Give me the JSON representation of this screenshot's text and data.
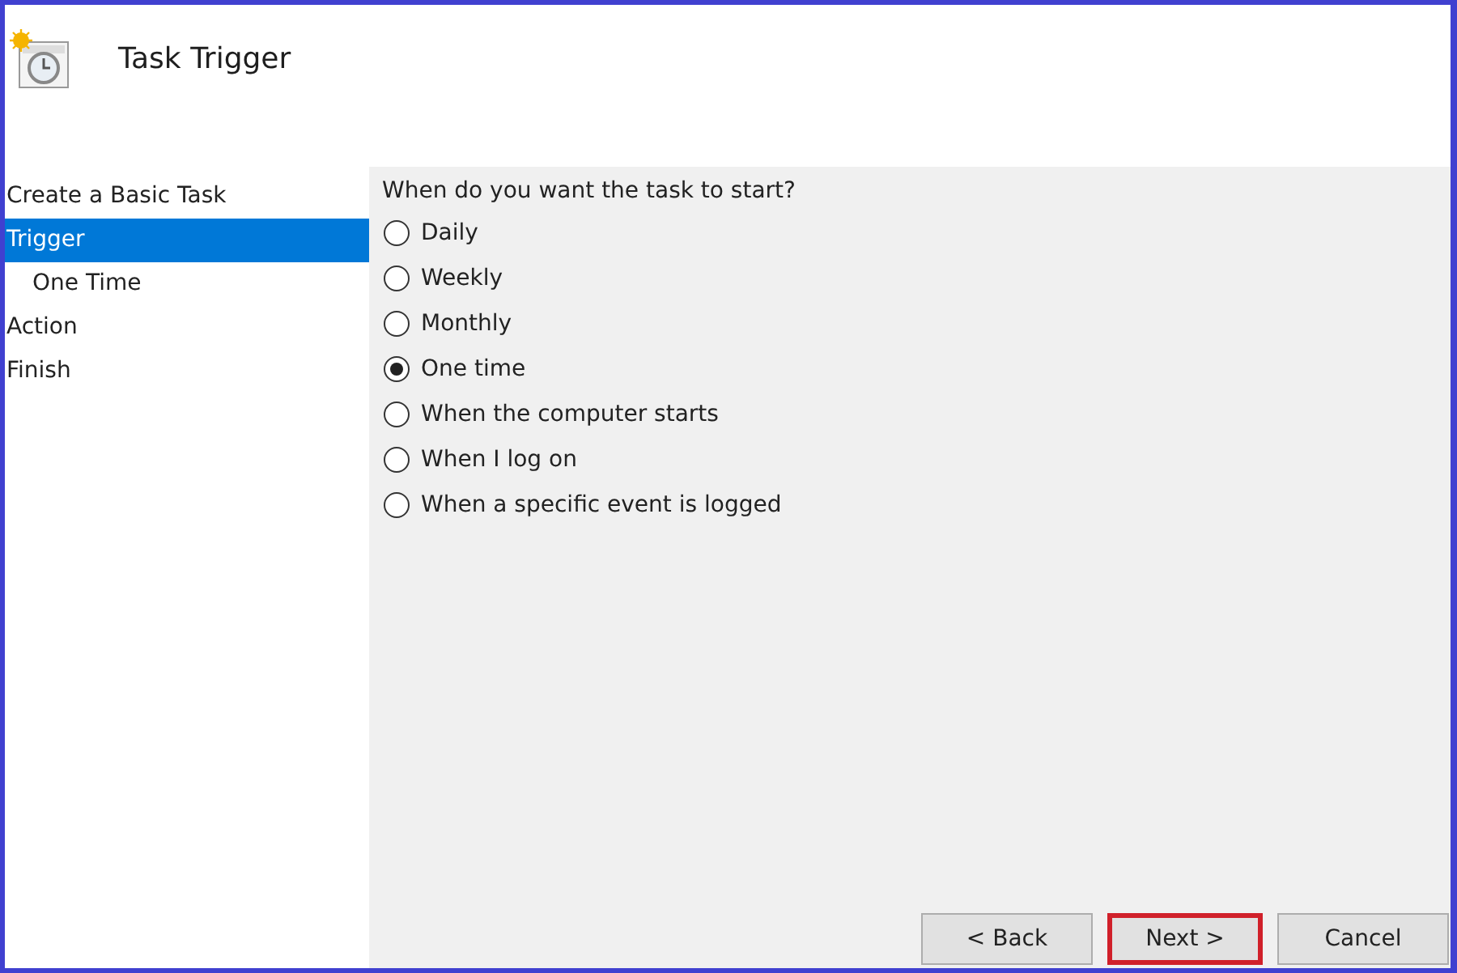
{
  "header": {
    "title": "Task Trigger"
  },
  "sidebar": {
    "items": [
      {
        "label": "Create a Basic Task",
        "selected": false
      },
      {
        "label": "Trigger",
        "selected": true,
        "children": [
          {
            "label": "One Time",
            "selected": false
          }
        ]
      },
      {
        "label": "Action",
        "selected": false
      },
      {
        "label": "Finish",
        "selected": false
      }
    ]
  },
  "question": "When do you want the task to start?",
  "options": [
    {
      "label": "Daily",
      "selected": false
    },
    {
      "label": "Weekly",
      "selected": false
    },
    {
      "label": "Monthly",
      "selected": false
    },
    {
      "label": "One time",
      "selected": true
    },
    {
      "label": "When the computer starts",
      "selected": false
    },
    {
      "label": "When I log on",
      "selected": false
    },
    {
      "label": "When a specific event is logged",
      "selected": false
    }
  ],
  "buttons": [
    {
      "label": "< Back",
      "highlighted": false
    },
    {
      "label": "Next >",
      "highlighted": true
    },
    {
      "label": "Cancel",
      "highlighted": false
    }
  ]
}
